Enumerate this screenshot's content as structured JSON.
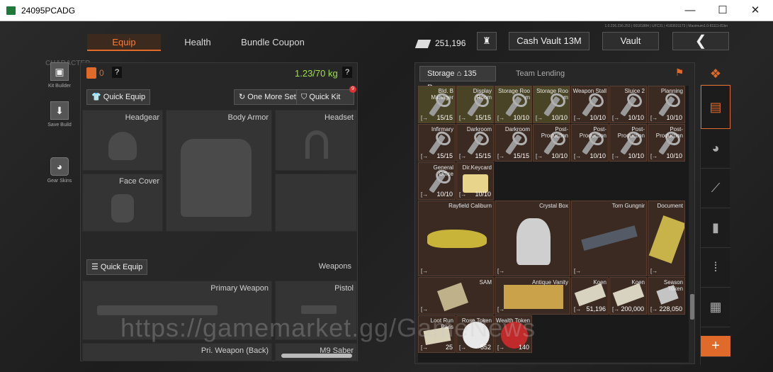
{
  "window": {
    "title": "24095PCADG",
    "minimize": "—",
    "maximize": "☐",
    "close": "✕"
  },
  "header": {
    "character_label": "CHARACTER",
    "tabs": [
      {
        "label": "Equip"
      },
      {
        "label": "Health"
      },
      {
        "label": "Bundle Coupon"
      }
    ],
    "money": "251,196",
    "cash_vault": "Cash Vault 13M",
    "vault": "Vault",
    "back": "❮",
    "version_info": "1.0.236.236.253 | 00181884 | UFC31 | 4183631173 | Maximum1.0-81111-81kn"
  },
  "sidebar": {
    "kit_builder": "Kit Builder",
    "save_build": "Save Build",
    "gear_skins": "Gear Skins"
  },
  "loadout": {
    "count": "0",
    "help": "?",
    "weight": "1.23/70 kg",
    "help2": "?",
    "quick_equip": "Quick Equip",
    "one_more_set": "One More Set",
    "quick_kit": "Quick Kit",
    "quick_kit_badge": "9",
    "slots": {
      "headgear": "Headgear",
      "body_armor": "Body Armor",
      "headset": "Headset",
      "face_cover": "Face Cover"
    },
    "quick_equip2": "Quick Equip",
    "weapons": "Weapons",
    "primary_weapon": "Primary Weapon",
    "pistol": "Pistol",
    "pri_weapon_back": "Pri. Weapon (Back)",
    "melee": "M9 Saber"
  },
  "storage": {
    "tab": "Storage",
    "rows": "135 Rows",
    "team_lending": "Team Lending",
    "row1": [
      {
        "name": "Bld. B Manager",
        "count": "15/15"
      },
      {
        "name": "Display Room",
        "count": "15/15"
      },
      {
        "name": "Storage Roo m",
        "count": "10/10"
      },
      {
        "name": "Storage Roo m",
        "count": "10/10"
      },
      {
        "name": "Weapon Stall",
        "count": "10/10"
      },
      {
        "name": "Sluice 2",
        "count": "10/10"
      },
      {
        "name": "Planning",
        "count": "10/10"
      }
    ],
    "row2": [
      {
        "name": "Infirmary",
        "count": "15/15"
      },
      {
        "name": "Darkroom",
        "count": "15/15"
      },
      {
        "name": "Darkroom",
        "count": "15/15"
      },
      {
        "name": "Post-Production",
        "count": "10/10"
      },
      {
        "name": "Post-Production",
        "count": "10/10"
      },
      {
        "name": "Post-Production",
        "count": "10/10"
      },
      {
        "name": "Post-Production",
        "count": "10/10"
      }
    ],
    "row3": [
      {
        "name": "General Office",
        "count": "10/10"
      },
      {
        "name": "Dir.Keycard",
        "count": "10/10"
      }
    ],
    "big": [
      {
        "name": "Rayfield Caliburn"
      },
      {
        "name": "Crystal Box"
      },
      {
        "name": "Torn Gungnir"
      },
      {
        "name": "Document"
      }
    ],
    "row5": [
      {
        "name": "SAM"
      },
      {
        "name": "Antique Vanity"
      },
      {
        "name": "Koen",
        "count": "51,196"
      },
      {
        "name": "Koen",
        "count": "200,000"
      },
      {
        "name": "Season Token",
        "count": "228,050"
      }
    ],
    "row6": [
      {
        "name": "Loot Run Pass",
        "count": "25"
      },
      {
        "name": "Rose Token",
        "count": "552"
      },
      {
        "name": "Wealth Token",
        "count": "140"
      }
    ],
    "mark": "[→"
  },
  "watermark": "https://gamemarket.gg/GameNews",
  "add": "+"
}
